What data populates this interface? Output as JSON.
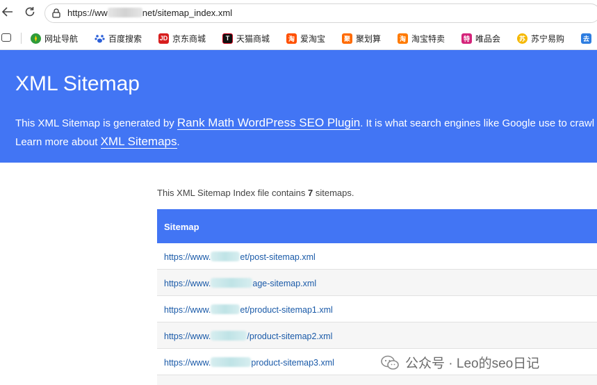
{
  "browser": {
    "url_prefix": "https://ww",
    "url_suffix": "net/sitemap_index.xml",
    "bookmarks": [
      {
        "label": "网址导航",
        "icon": "compass-icon",
        "color": "#2e9b3a"
      },
      {
        "label": "百度搜索",
        "icon": "baidu-paw-icon",
        "color": "#2a5ed8"
      },
      {
        "label": "京东商城",
        "icon": "jd-icon",
        "color": "#d71e1e",
        "glyph": "JD"
      },
      {
        "label": "天猫商城",
        "icon": "tmall-icon",
        "color": "#111111",
        "glyph": "T"
      },
      {
        "label": "爱淘宝",
        "icon": "aitaobao-icon",
        "color": "#ff5000",
        "glyph": "淘"
      },
      {
        "label": "聚划算",
        "icon": "juhuasuan-icon",
        "color": "#ff6a00",
        "glyph": "聚"
      },
      {
        "label": "淘宝特卖",
        "icon": "taobao-sale-icon",
        "color": "#ff7a00",
        "glyph": "淘"
      },
      {
        "label": "唯品会",
        "icon": "vip-icon",
        "color": "#d4237a",
        "glyph": "特"
      },
      {
        "label": "苏宁易购",
        "icon": "suning-icon",
        "color": "#f5b800",
        "glyph": "苏"
      },
      {
        "label": "",
        "icon": "more-bookmark-icon",
        "color": "#2d7de0",
        "glyph": "去"
      }
    ]
  },
  "banner": {
    "title": "XML Sitemap",
    "line1_pre": "This XML Sitemap is generated by ",
    "line1_link": "Rank Math WordPress SEO Plugin",
    "line1_post": ". It is what search engines like Google use to crawl a",
    "line2_pre": "Learn more about ",
    "line2_link": "XML Sitemaps",
    "line2_post": "."
  },
  "content": {
    "summary_pre": "This XML Sitemap Index file contains ",
    "summary_count": "7",
    "summary_post": " sitemaps.",
    "column_header": "Sitemap",
    "rows": [
      {
        "pre": "https://www.",
        "post": "et/post-sitemap.xml"
      },
      {
        "pre": "https://www.",
        "post": "age-sitemap.xml"
      },
      {
        "pre": "https://www.",
        "post": "et/product-sitemap1.xml"
      },
      {
        "pre": "https://www.",
        "post": "/product-sitemap2.xml"
      },
      {
        "pre": "https://www.",
        "post": "product-sitemap3.xml"
      }
    ]
  },
  "watermark": {
    "text": "公众号 · Leo的seo日记"
  },
  "colors": {
    "accent": "#4275f4",
    "link": "#1a5aa8"
  }
}
